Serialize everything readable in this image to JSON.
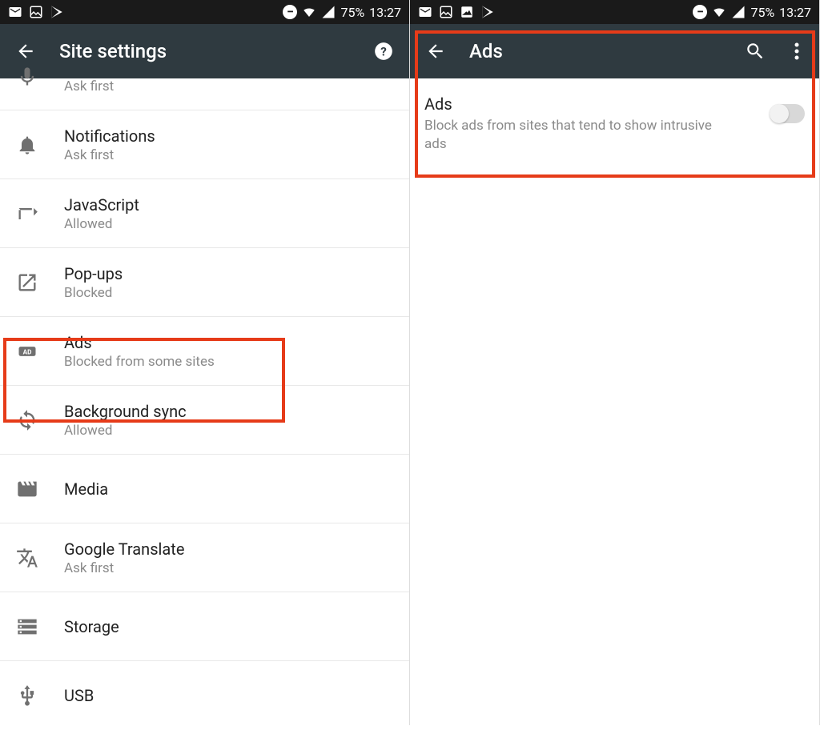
{
  "status": {
    "battery": "75%",
    "time": "13:27"
  },
  "left": {
    "title": "Site settings",
    "items": [
      {
        "icon": "mic",
        "label": "Microphone",
        "sub": "Ask first",
        "partial": true
      },
      {
        "icon": "bell",
        "label": "Notifications",
        "sub": "Ask first"
      },
      {
        "icon": "javascript",
        "label": "JavaScript",
        "sub": "Allowed"
      },
      {
        "icon": "popup",
        "label": "Pop-ups",
        "sub": "Blocked"
      },
      {
        "icon": "ads",
        "label": "Ads",
        "sub": "Blocked from some sites",
        "highlighted": true
      },
      {
        "icon": "sync",
        "label": "Background sync",
        "sub": "Allowed"
      },
      {
        "icon": "media",
        "label": "Media",
        "sub": ""
      },
      {
        "icon": "translate",
        "label": "Google Translate",
        "sub": "Ask first"
      },
      {
        "icon": "storage",
        "label": "Storage",
        "sub": ""
      },
      {
        "icon": "usb",
        "label": "USB",
        "sub": ""
      }
    ]
  },
  "right": {
    "title": "Ads",
    "detail": {
      "label": "Ads",
      "sub": "Block ads from sites that tend to show intrusive ads",
      "toggle": false
    }
  }
}
